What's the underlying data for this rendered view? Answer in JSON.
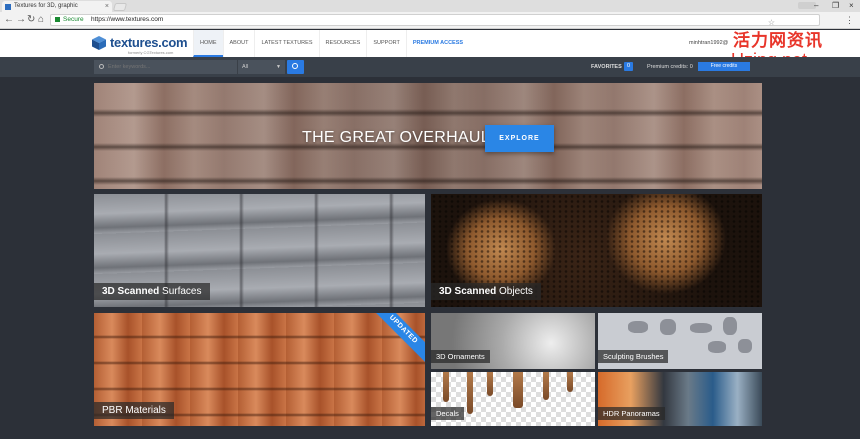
{
  "browser": {
    "tab_title": "Textures for 3D, graphic",
    "secure_label": "Secure",
    "url": "https://www.textures.com"
  },
  "site": {
    "logo_text": "textures.com",
    "logo_tagline": "formerly CGTextures.com",
    "nav": [
      "HOME",
      "ABOUT",
      "LATEST TEXTURES",
      "RESOURCES",
      "SUPPORT",
      "PREMIUM ACCESS"
    ],
    "account_name": "minhtran1992@",
    "watermark_line1": "活力网资讯",
    "watermark_line2": "Uzing.net"
  },
  "searchbar": {
    "placeholder": "Enter keywords...",
    "category": "All",
    "favorites_label": "FAVORITES",
    "favorites_count": "0",
    "premium_credits_label": "Premium credits: 0",
    "free_credits_label": "Free credits"
  },
  "hero": {
    "title": "THE GREAT OVERHAUL",
    "button": "EXPLORE"
  },
  "tiles": {
    "surfaces": {
      "bold": "3D Scanned",
      "rest": " Surfaces"
    },
    "objects": {
      "bold": "3D Scanned",
      "rest": " Objects"
    },
    "pbr": {
      "label": "PBR Materials",
      "badge": "UPDATED"
    },
    "ornaments": "3D Ornaments",
    "sculpting": "Sculpting Brushes",
    "decals": "Decals",
    "hdr": "HDR Panoramas"
  },
  "colors": {
    "accent": "#2a86e6",
    "brand": "#1e4f8f",
    "secure": "#1a8a32",
    "watermark": "#e8352a"
  }
}
